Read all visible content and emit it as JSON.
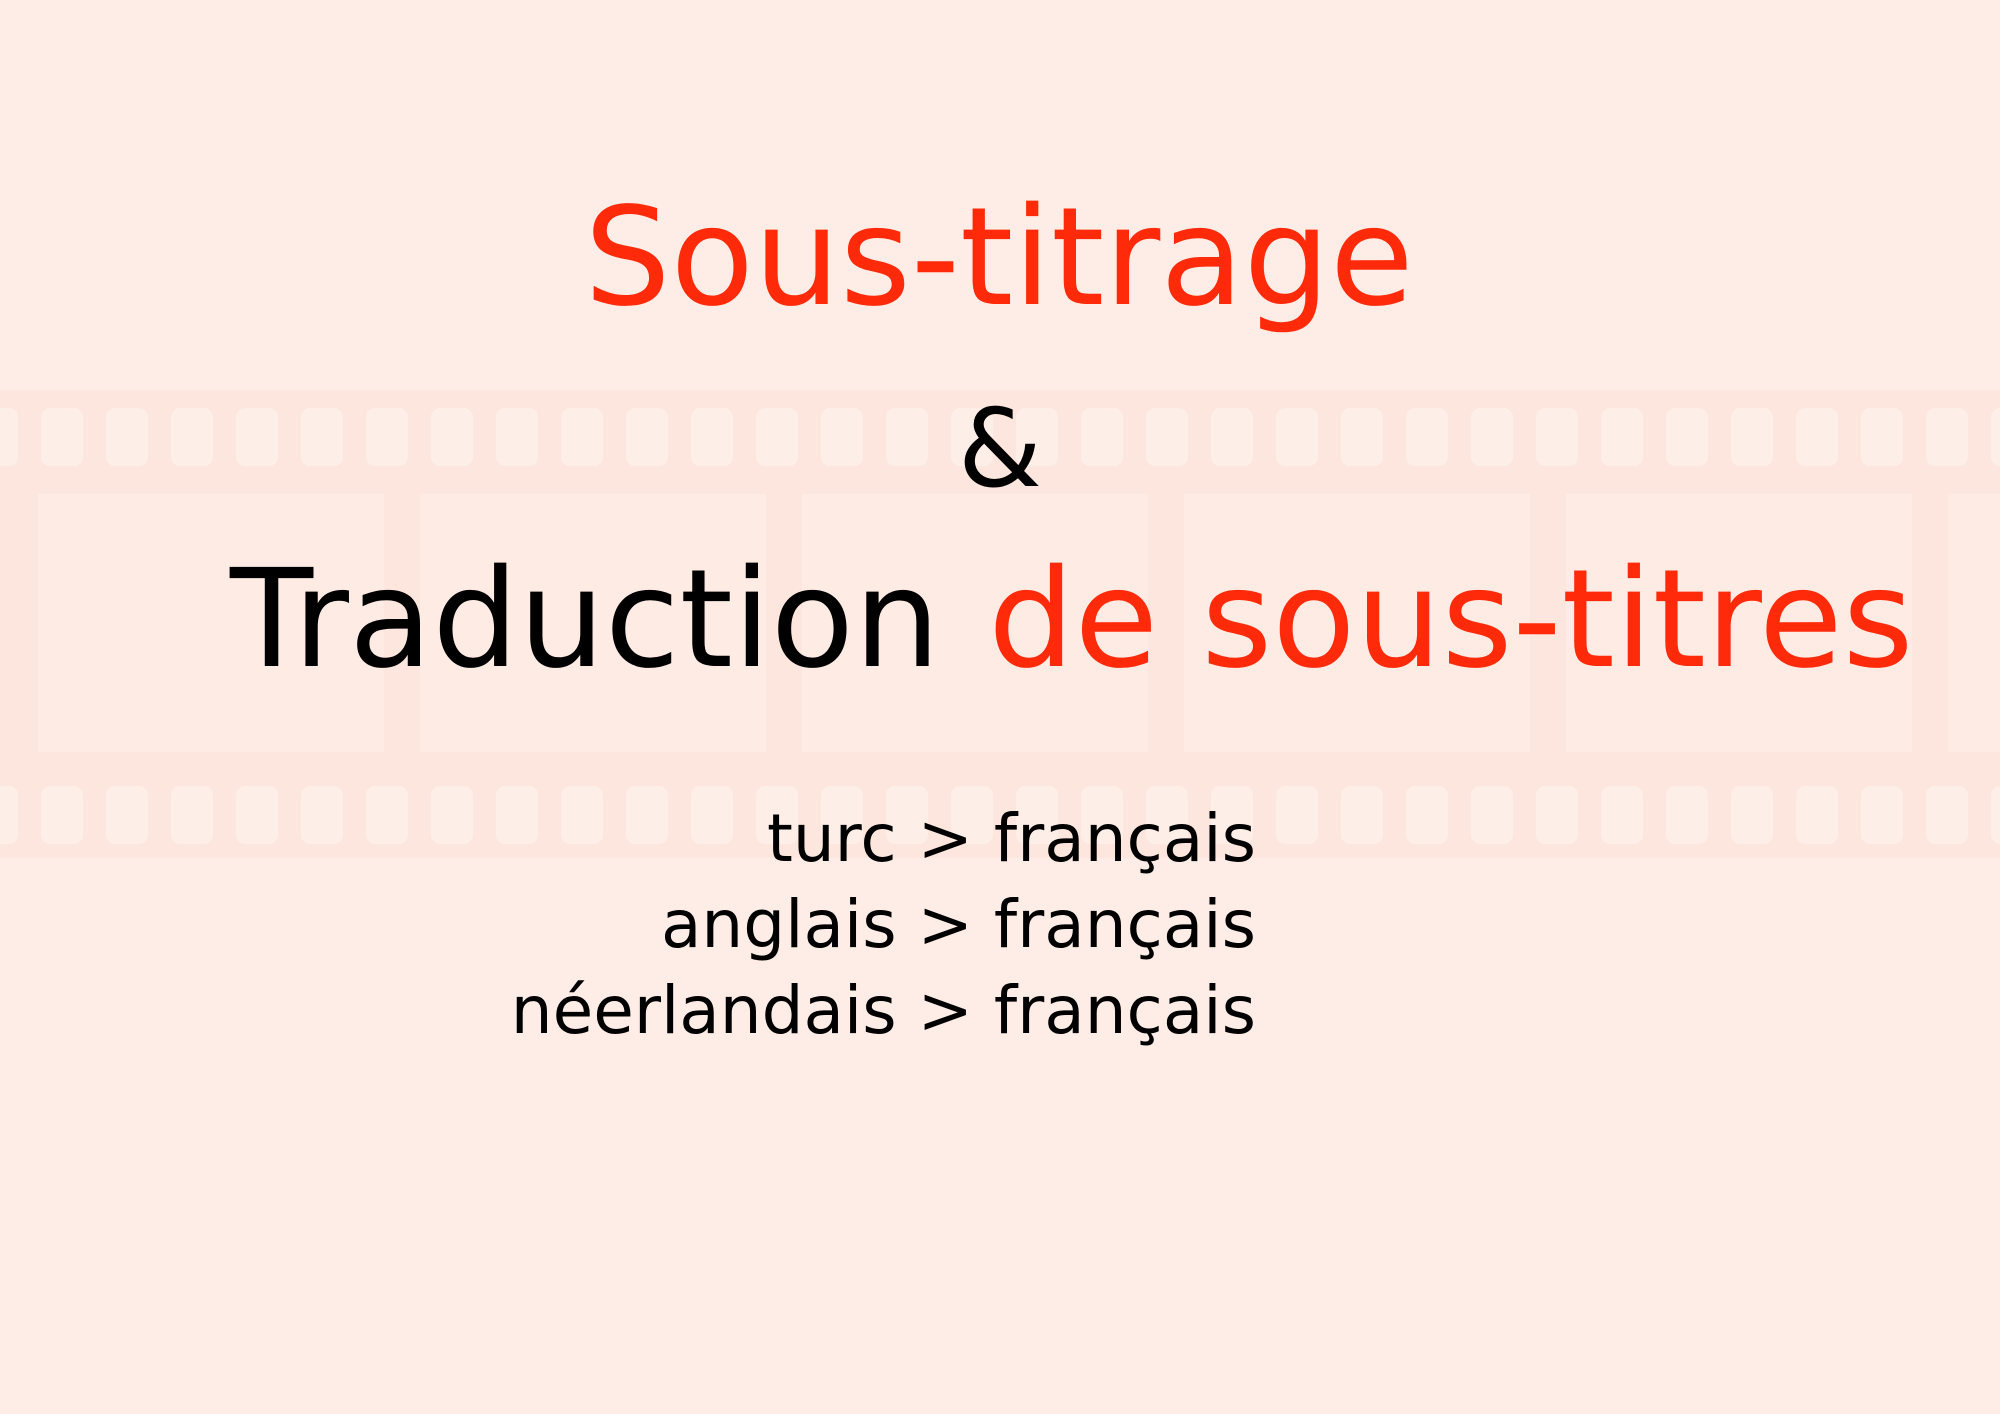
{
  "heading": {
    "line1": "Sous-titrage",
    "ampersand": "&",
    "line3_black": "Traduction",
    "line3_red": "de sous-titres"
  },
  "language_pairs": [
    "turc > français",
    "anglais > français",
    "néerlandais > français"
  ],
  "colors": {
    "background": "#FDEDE6",
    "accent_red": "#FF2A0A",
    "text_black": "#000000",
    "filmstrip": "#FCE6DD"
  }
}
